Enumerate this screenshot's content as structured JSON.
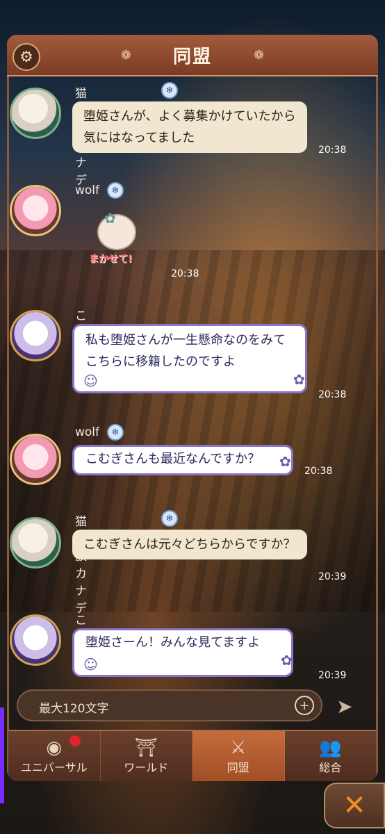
{
  "header": {
    "title": "同盟",
    "gear_icon": "gear-icon",
    "ornament": "❁"
  },
  "messages": [
    {
      "user": "猫霊族カナデ",
      "text": "堕姫さんが、よく募集かけていたから気にはなってました",
      "time": "20:38"
    },
    {
      "user": "wolf",
      "sticker_caption": "まかせて!",
      "time": "20:38"
    },
    {
      "user": "こむぎ",
      "text": "私も堕姫さんが一生懸命なのをみてこちらに移籍したのですよ",
      "time": "20:38"
    },
    {
      "user": "wolf",
      "text": "こむぎさんも最近なんですか？",
      "time": "20:38"
    },
    {
      "user": "猫霊族カナデ",
      "text": "こむぎさんは元々どちらからですか？",
      "time": "20:39"
    },
    {
      "user": "こむぎ",
      "text": "堕姫さーん！みんな見てますよ",
      "time": "20:39"
    }
  ],
  "input": {
    "placeholder": "最大120文字",
    "plus": "+",
    "send": "➤"
  },
  "tabs": [
    {
      "label": "ユニバーサル",
      "icon": "globe-icon",
      "glyph": "◉",
      "notify": true
    },
    {
      "label": "ワールド",
      "icon": "gate-icon",
      "glyph": "⛩"
    },
    {
      "label": "同盟",
      "icon": "crossed-swords-icon",
      "glyph": "⚔",
      "active": true
    },
    {
      "label": "総合",
      "icon": "people-icon",
      "glyph": "👥"
    }
  ],
  "close": "✕"
}
